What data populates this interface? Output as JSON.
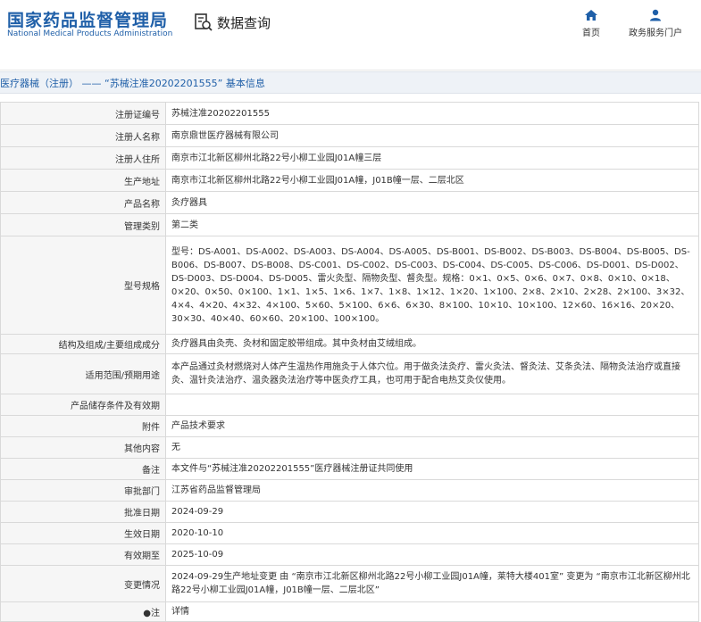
{
  "header": {
    "logo_cn": "国家药品监督管理局",
    "logo_en": "National Medical Products Administration",
    "query_label": "数据查询",
    "nav": [
      {
        "label": "首页",
        "icon": "home-icon"
      },
      {
        "label": "政务服务门户",
        "icon": "user-icon"
      }
    ]
  },
  "breadcrumb": "医疗器械（注册） —— “苏械注准20202201555” 基本信息",
  "rows": [
    {
      "label": "注册证编号",
      "value": "苏械注准20202201555"
    },
    {
      "label": "注册人名称",
      "value": "南京鼎世医疗器械有限公司"
    },
    {
      "label": "注册人住所",
      "value": "南京市江北新区柳州北路22号小柳工业园J01A幢三层"
    },
    {
      "label": "生产地址",
      "value": "南京市江北新区柳州北路22号小柳工业园J01A幢，J01B幢一层、二层北区"
    },
    {
      "label": "产品名称",
      "value": "灸疗器具"
    },
    {
      "label": "管理类别",
      "value": "第二类"
    },
    {
      "label": "型号规格",
      "value": "型号：DS-A001、DS-A002、DS-A003、DS-A004、DS-A005、DS-B001、DS-B002、DS-B003、DS-B004、DS-B005、DS-B006、DS-B007、DS-B008、DS-C001、DS-C002、DS-C003、DS-C004、DS-C005、DS-C006、DS-D001、DS-D002、DS-D003、DS-D004、DS-D005、雷火灸型、隔物灸型、督灸型。规格：0×1、0×5、0×6、0×7、0×8、0×10、0×18、0×20、0×50、0×100、1×1、1×5、1×6、1×7、1×8、1×12、1×20、1×100、2×8、2×10、2×28、2×100、3×32、4×4、4×20、4×32、4×100、5×60、5×100、6×6、6×30、8×100、10×10、10×100、12×60、16×16、20×20、30×30、40×40、60×60、20×100、100×100。"
    },
    {
      "label": "结构及组成/主要组成成分",
      "value": "灸疗器具由灸壳、灸材和固定胶带组成。其中灸材由艾绒组成。"
    },
    {
      "label": "适用范围/预期用途",
      "value": "本产品通过灸材燃烧对人体产生温热作用施灸于人体穴位。用于做灸法灸疗、雷火灸法、督灸法、艾条灸法、隔物灸法治疗或直接灸、温针灸法治疗、温灸器灸法治疗等中医灸疗工具，也可用于配合电热艾灸仪使用。"
    },
    {
      "label": "产品储存条件及有效期",
      "value": ""
    },
    {
      "label": "附件",
      "value": "产品技术要求"
    },
    {
      "label": "其他内容",
      "value": "无"
    },
    {
      "label": "备注",
      "value": "本文件与“苏械注准20202201555”医疗器械注册证共同使用"
    },
    {
      "label": "审批部门",
      "value": "江苏省药品监督管理局"
    },
    {
      "label": "批准日期",
      "value": "2024-09-29"
    },
    {
      "label": "生效日期",
      "value": "2020-10-10"
    },
    {
      "label": "有效期至",
      "value": "2025-10-09"
    },
    {
      "label": "变更情况",
      "value": "2024-09-29生产地址变更 由 “南京市江北新区柳州北路22号小柳工业园J01A幢，莱特大楼401室” 变更为 “南京市江北新区柳州北路22号小柳工业园J01A幢，J01B幢一层、二层北区”"
    },
    {
      "label": "●注",
      "value": "详情"
    }
  ]
}
